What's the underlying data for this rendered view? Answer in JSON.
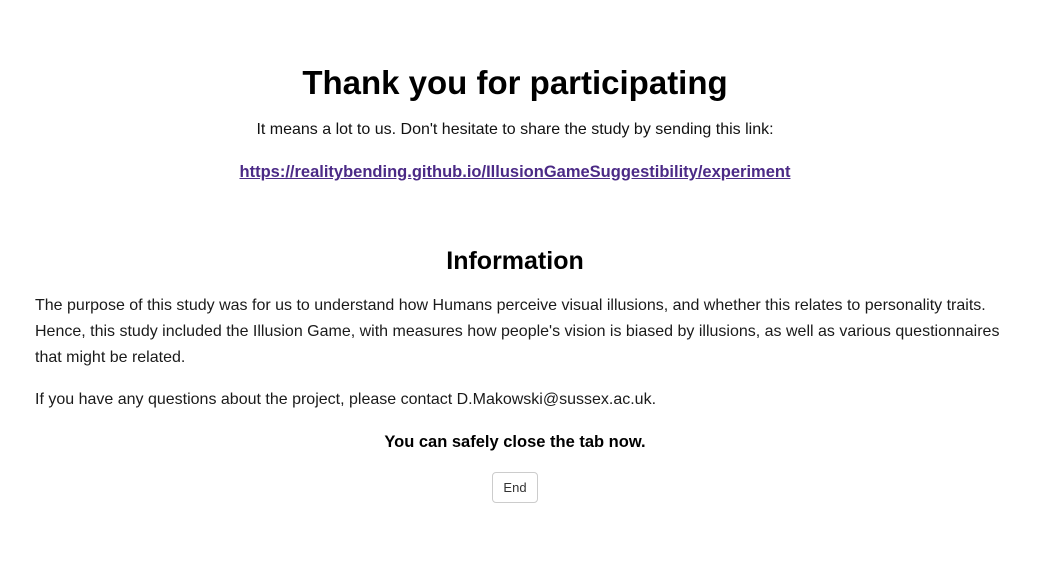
{
  "header": {
    "title": "Thank you for participating",
    "subtitle": "It means a lot to us. Don't hesitate to share the study by sending this link:",
    "link_text": "https://realitybending.github.io/IllusionGameSuggestibility/experiment",
    "link_color": "#4b2a86"
  },
  "information": {
    "heading": "Information",
    "paragraph_1": "The purpose of this study was for us to understand how Humans perceive visual illusions, and whether this relates to personality traits. Hence, this study included the Illusion Game, with measures how people's vision is biased by illusions, as well as various questionnaires that might be related.",
    "paragraph_2": "If you have any questions about the project, please contact D.Makowski@sussex.ac.uk.",
    "close_note": "You can safely close the tab now."
  },
  "actions": {
    "end_label": "End"
  }
}
